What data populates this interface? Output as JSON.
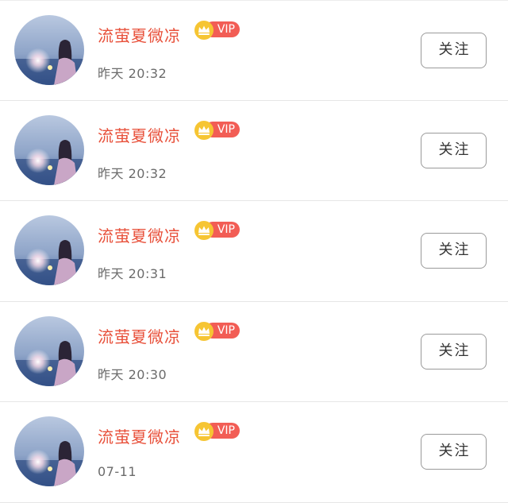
{
  "feed": {
    "items": [
      {
        "name": "流萤夏微凉",
        "badge": "VIP",
        "time": "昨天 20:32",
        "action": "关注"
      },
      {
        "name": "流萤夏微凉",
        "badge": "VIP",
        "time": "昨天 20:32",
        "action": "关注"
      },
      {
        "name": "流萤夏微凉",
        "badge": "VIP",
        "time": "昨天 20:31",
        "action": "关注"
      },
      {
        "name": "流萤夏微凉",
        "badge": "VIP",
        "time": "昨天 20:30",
        "action": "关注"
      },
      {
        "name": "流萤夏微凉",
        "badge": "VIP",
        "time": "07-11",
        "action": "关注"
      }
    ]
  },
  "icons": {
    "avatar": "avatar-photo",
    "crown": "crown-icon"
  },
  "colors": {
    "name": "#e8513b",
    "vip_badge": "#f25d55",
    "crown": "#f6c533",
    "time": "#6b6b6b",
    "button_border": "#9a9a9a"
  }
}
